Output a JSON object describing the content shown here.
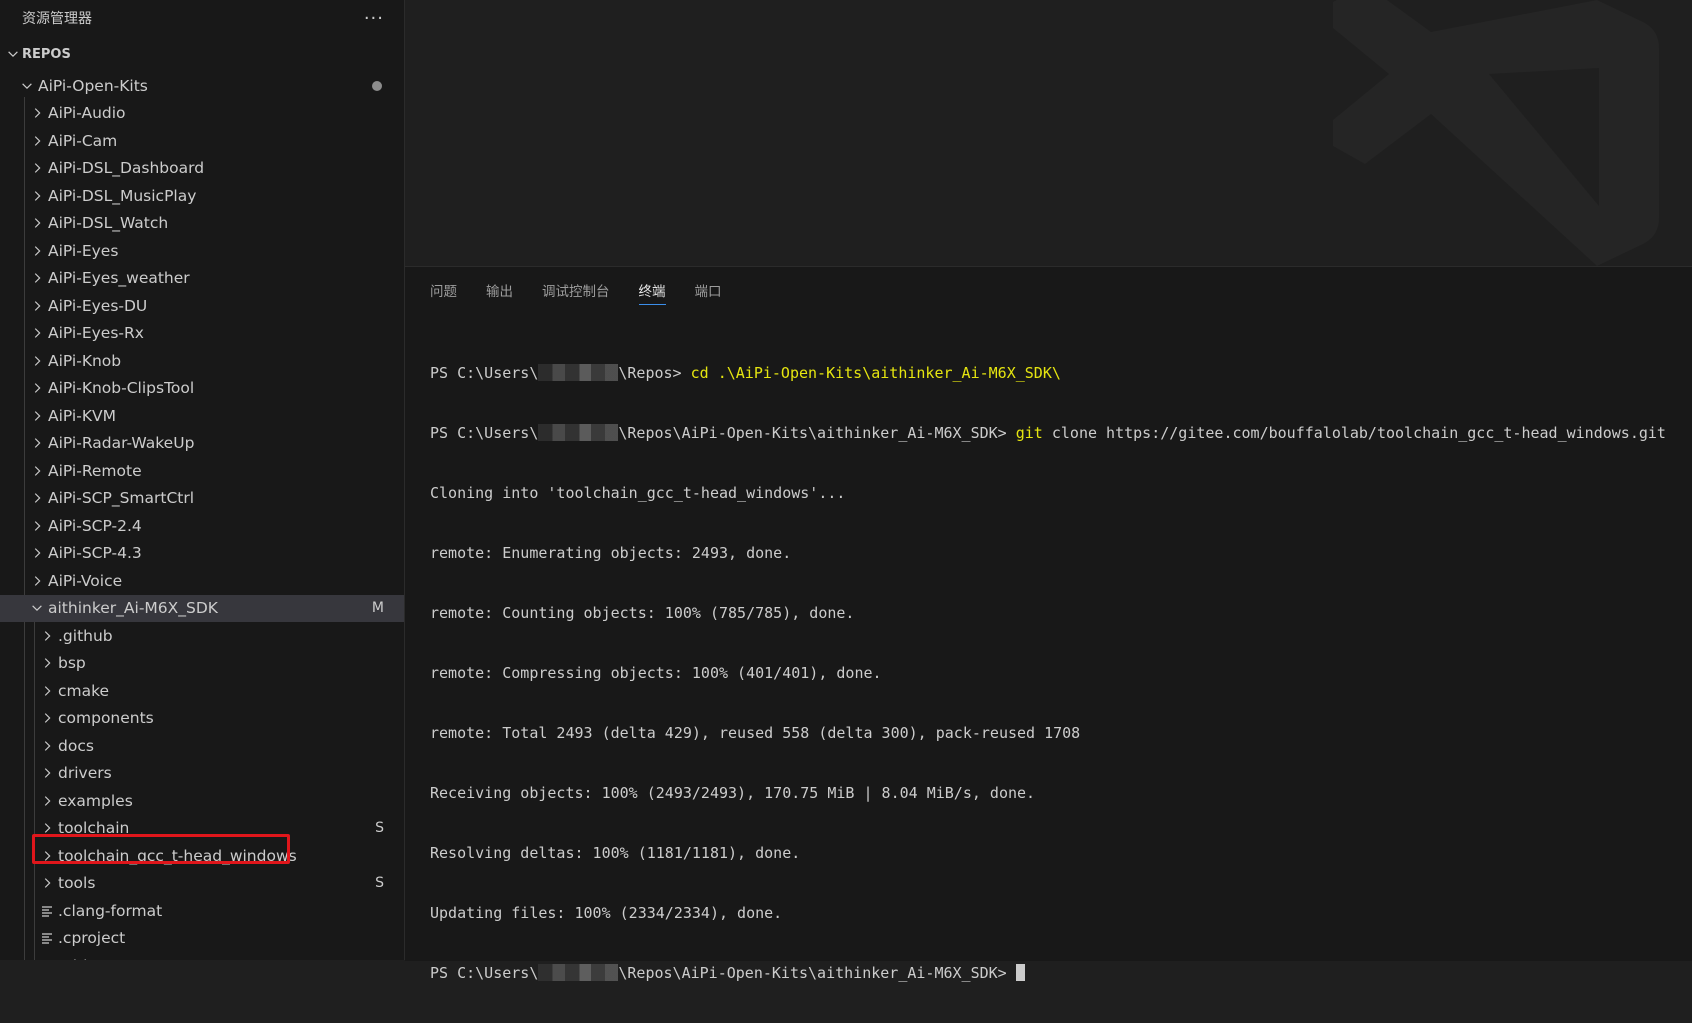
{
  "explorer": {
    "title": "资源管理器",
    "more_icon": "···",
    "section": "REPOS",
    "root": {
      "label": "AiPi-Open-Kits"
    },
    "projects": [
      "AiPi-Audio",
      "AiPi-Cam",
      "AiPi-DSL_Dashboard",
      "AiPi-DSL_MusicPlay",
      "AiPi-DSL_Watch",
      "AiPi-Eyes",
      "AiPi-Eyes_weather",
      "AiPi-Eyes-DU",
      "AiPi-Eyes-Rx",
      "AiPi-Knob",
      "AiPi-Knob-ClipsTool",
      "AiPi-KVM",
      "AiPi-Radar-WakeUp",
      "AiPi-Remote",
      "AiPi-SCP_SmartCtrl",
      "AiPi-SCP-2.4",
      "AiPi-SCP-4.3",
      "AiPi-Voice"
    ],
    "sdk_folder": {
      "label": "aithinker_Ai-M6X_SDK",
      "badge": "M"
    },
    "sdk_children": [
      {
        "label": ".github",
        "badge": ""
      },
      {
        "label": "bsp",
        "badge": ""
      },
      {
        "label": "cmake",
        "badge": ""
      },
      {
        "label": "components",
        "badge": ""
      },
      {
        "label": "docs",
        "badge": ""
      },
      {
        "label": "drivers",
        "badge": ""
      },
      {
        "label": "examples",
        "badge": ""
      },
      {
        "label": "toolchain",
        "badge": "S"
      },
      {
        "label": "toolchain_gcc_t-head_windows",
        "badge": ""
      },
      {
        "label": "tools",
        "badge": "S"
      }
    ],
    "sdk_files": [
      ".clang-format",
      ".cproject",
      ".gitignore"
    ]
  },
  "panel": {
    "tabs": [
      "问题",
      "输出",
      "调试控制台",
      "终端",
      "端口"
    ],
    "active_tab": "终端"
  },
  "terminal": {
    "prompt_prefix": "PS C:\\Users\\",
    "line1_rest": "\\Repos> ",
    "line1_cmd": "cd .\\AiPi-Open-Kits\\aithinker_Ai-M6X_SDK\\",
    "line2_rest": "\\Repos\\AiPi-Open-Kits\\aithinker_Ai-M6X_SDK> ",
    "line2_cmd": "git",
    "line2_args": " clone https://gitee.com/bouffalolab/toolchain_gcc_t-head_windows.git",
    "output": [
      "Cloning into 'toolchain_gcc_t-head_windows'...",
      "remote: Enumerating objects: 2493, done.",
      "remote: Counting objects: 100% (785/785), done.",
      "remote: Compressing objects: 100% (401/401), done.",
      "remote: Total 2493 (delta 429), reused 558 (delta 300), pack-reused 1708",
      "Receiving objects: 100% (2493/2493), 170.75 MiB | 8.04 MiB/s, done.",
      "Resolving deltas: 100% (1181/1181), done.",
      "Updating files: 100% (2334/2334), done."
    ],
    "last_rest": "\\Repos\\AiPi-Open-Kits\\aithinker_Ai-M6X_SDK> "
  },
  "colors": {
    "highlight": "#e0161b",
    "command": "#e5e510",
    "active_tab_underline": "#3b8eea"
  }
}
